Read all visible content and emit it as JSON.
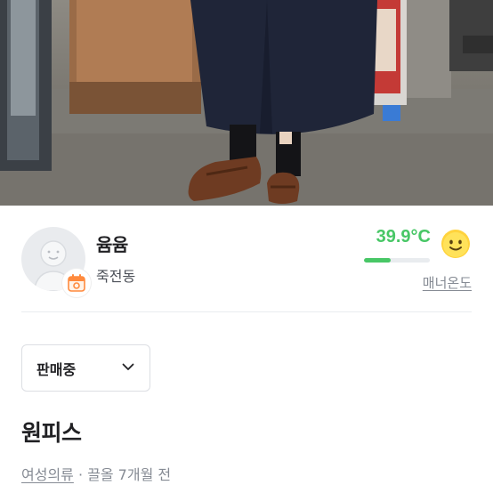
{
  "product_photo": {
    "icon": "product-photo",
    "description_icon": "photo-of-navy-dress-and-brown-loafers"
  },
  "seller": {
    "nickname": "윰윰",
    "region": "죽전동",
    "avatar_icon": "default-avatar-icon",
    "badge_icon": "calendar-badge-icon",
    "temperature": "39.9°C",
    "temperature_value": 39.9,
    "temperature_bar_fraction": 0.399,
    "temperature_color": "#48c766",
    "face_icon": "smile-face-icon",
    "manner_label": "매너온도"
  },
  "status": {
    "selected": "판매중",
    "icon": "chevron-down-icon"
  },
  "product": {
    "title": "원피스",
    "category": "여성의류",
    "separator": " · ",
    "bump_time": "끌올 7개월 전"
  }
}
